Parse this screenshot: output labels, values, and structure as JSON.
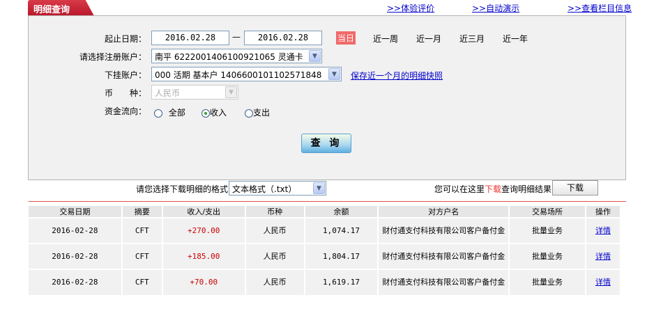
{
  "tab": {
    "title": "明细查询"
  },
  "top_links": [
    {
      "prefix": ">>",
      "label": "体验评价"
    },
    {
      "prefix": ">>",
      "label": "自动演示"
    },
    {
      "prefix": ">>",
      "label": "查看栏目信息"
    }
  ],
  "form": {
    "date_label": "起止日期：",
    "start_date": "2016.02.28",
    "dash": "—",
    "end_date": "2016.02.28",
    "quick_ranges": [
      "当日",
      "近一周",
      "近一月",
      "近三月",
      "近一年"
    ],
    "active_range": "当日",
    "account_label": "请选择注册账户：",
    "account_value": "南平 6222001406100921065 灵通卡",
    "sub_account_label": "下挂账户：",
    "sub_account_value": "000 活期 基本户 1406600101102571848",
    "snapshot_link": "保存近一个月的明细快照",
    "currency_label": "币　　种：",
    "currency_value": "人民币",
    "flow_label": "资金流向：",
    "flow_options": [
      "全部",
      "收入",
      "支出"
    ],
    "flow_selected": "收入",
    "query_button": "查 询"
  },
  "download": {
    "format_label": "请您选择下载明细的格式",
    "format_value": "文本格式（.txt）",
    "hint_prefix": "您可以在这里",
    "hint_highlight": "下载",
    "hint_suffix": "查询明细结果",
    "button": "下载"
  },
  "table": {
    "headers": [
      "交易日期",
      "摘要",
      "收入/支出",
      "币种",
      "余额",
      "对方户名",
      "交易场所",
      "操作"
    ],
    "rows": [
      [
        "2016-02-28",
        "CFT",
        "+270.00",
        "人民币",
        "1,074.17",
        "财付通支付科技有限公司客户备付金",
        "批量业务",
        "详情"
      ],
      [
        "2016-02-28",
        "CFT",
        "+185.00",
        "人民币",
        "1,804.17",
        "财付通支付科技有限公司客户备付金",
        "批量业务",
        "详情"
      ],
      [
        "2016-02-28",
        "CFT",
        "+70.00",
        "人民币",
        "1,619.17",
        "财付通支付科技有限公司客户备付金",
        "批量业务",
        "详情"
      ]
    ]
  },
  "colors": {
    "tab": "#c0202f",
    "active_range": "#f06a6a",
    "amount": "#cc0000",
    "link": "#0000cc",
    "divider": "#e05050"
  }
}
